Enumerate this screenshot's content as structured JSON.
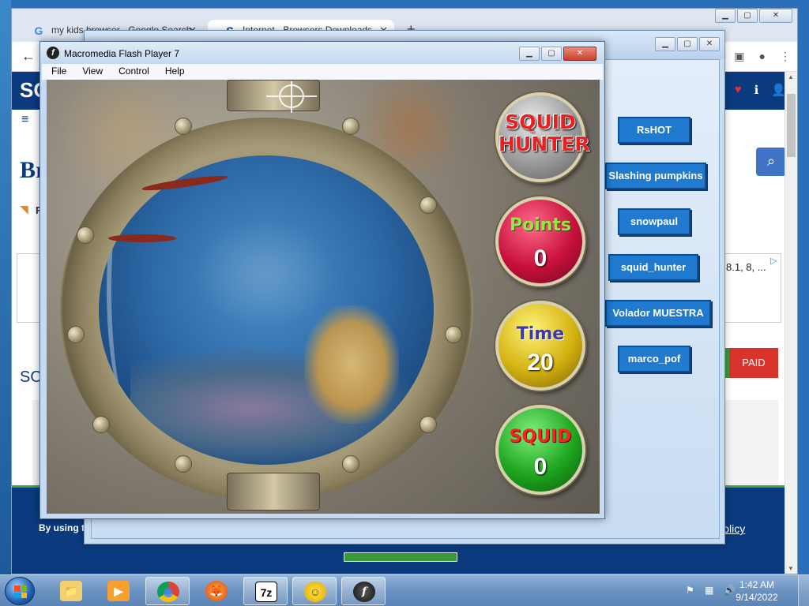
{
  "chrome": {
    "tabs": [
      {
        "label": "my kids browser - Google Search",
        "icon": "G"
      },
      {
        "label": "Internet - Browsers Downloads",
        "icon": "S"
      }
    ],
    "new_tab": "+",
    "back": "←",
    "window_controls": {
      "minimize": "▁",
      "maximize": "▢",
      "close": "✕"
    }
  },
  "site": {
    "logo": "SO",
    "page_title": "Br",
    "rss_text": "R",
    "ad_text": "8.1, 8, ...",
    "section_heading": "SO",
    "paid_label": "PAID",
    "footer_left": "By using tr",
    "footer_right": "y Policy"
  },
  "downloads_window": {
    "buttons": [
      "RsHOT",
      "Slashing pumpkins",
      "snowpaul",
      "squid_hunter",
      "Volador MUESTRA",
      "marco_pof"
    ]
  },
  "flash_player": {
    "title": "Macromedia Flash Player 7",
    "icon_glyph": "f",
    "menu": [
      "File",
      "View",
      "Control",
      "Help"
    ],
    "controls": {
      "minimize": "▁",
      "maximize": "▢",
      "close": "✕"
    }
  },
  "game": {
    "logo": "SQUID\nHUNTER",
    "points_label": "Points",
    "points_value": "0",
    "time_label": "Time",
    "time_value": "20",
    "squid_label": "SQUID",
    "squid_value": "0"
  },
  "taskbar": {
    "items": [
      {
        "name": "file-explorer",
        "glyph": "📁"
      },
      {
        "name": "media-player",
        "glyph": "▶"
      },
      {
        "name": "chrome",
        "glyph": "◉"
      },
      {
        "name": "firefox",
        "glyph": "🦊"
      },
      {
        "name": "7zip",
        "glyph": "7z"
      },
      {
        "name": "sun-app",
        "glyph": "☺"
      },
      {
        "name": "flash-player",
        "glyph": "f"
      }
    ],
    "clock_time": "1:42 AM",
    "clock_date": "9/14/2022"
  },
  "colors": {
    "site_header": "#0b3a7e",
    "download_button": "#1f7ad0",
    "paid": "#d9342b"
  }
}
